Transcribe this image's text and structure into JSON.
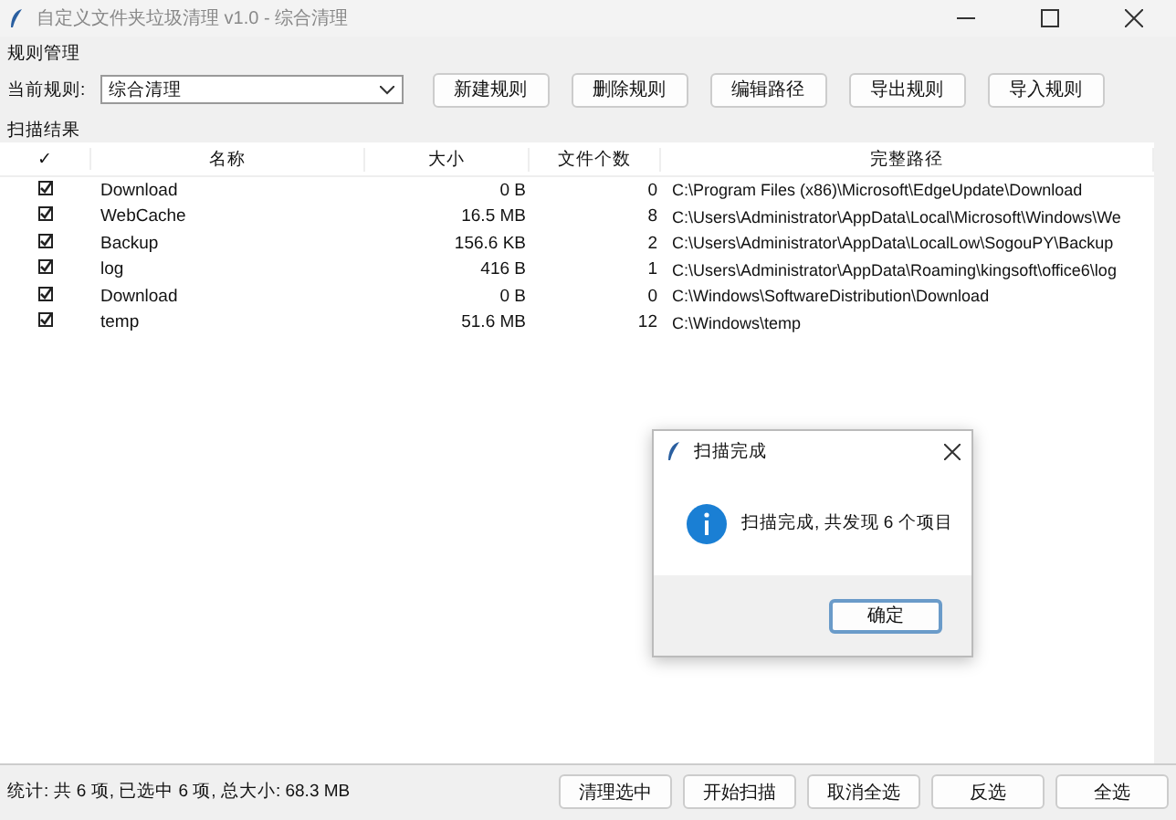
{
  "window": {
    "title": "自定义文件夹垃圾清理 v1.0 - 综合清理"
  },
  "rules": {
    "section_label": "规则管理",
    "current_label": "当前规则:",
    "current_value": "综合清理",
    "buttons": [
      "新建规则",
      "删除规则",
      "编辑路径",
      "导出规则",
      "导入规则"
    ]
  },
  "results": {
    "section_label": "扫描结果",
    "columns": [
      "✓",
      "名称",
      "大小",
      "文件个数",
      "完整路径"
    ],
    "rows": [
      {
        "checked": true,
        "name": "Download",
        "size": "0 B",
        "count": "0",
        "path": "C:\\Program Files (x86)\\Microsoft\\EdgeUpdate\\Download"
      },
      {
        "checked": true,
        "name": "WebCache",
        "size": "16.5 MB",
        "count": "8",
        "path": "C:\\Users\\Administrator\\AppData\\Local\\Microsoft\\Windows\\We"
      },
      {
        "checked": true,
        "name": "Backup",
        "size": "156.6 KB",
        "count": "2",
        "path": "C:\\Users\\Administrator\\AppData\\LocalLow\\SogouPY\\Backup"
      },
      {
        "checked": true,
        "name": "log",
        "size": "416 B",
        "count": "1",
        "path": "C:\\Users\\Administrator\\AppData\\Roaming\\kingsoft\\office6\\log"
      },
      {
        "checked": true,
        "name": "Download",
        "size": "0 B",
        "count": "0",
        "path": "C:\\Windows\\SoftwareDistribution\\Download"
      },
      {
        "checked": true,
        "name": "temp",
        "size": "51.6 MB",
        "count": "12",
        "path": "C:\\Windows\\temp"
      }
    ]
  },
  "status_bar": {
    "text": "统计: 共 6 项, 已选中 6 项, 总大小: 68.3 MB",
    "buttons": [
      "清理选中",
      "开始扫描",
      "取消全选",
      "反选",
      "全选"
    ]
  },
  "dialog": {
    "title": "扫描完成",
    "message": "扫描完成, 共发现 6 个项目",
    "button": "确定"
  }
}
